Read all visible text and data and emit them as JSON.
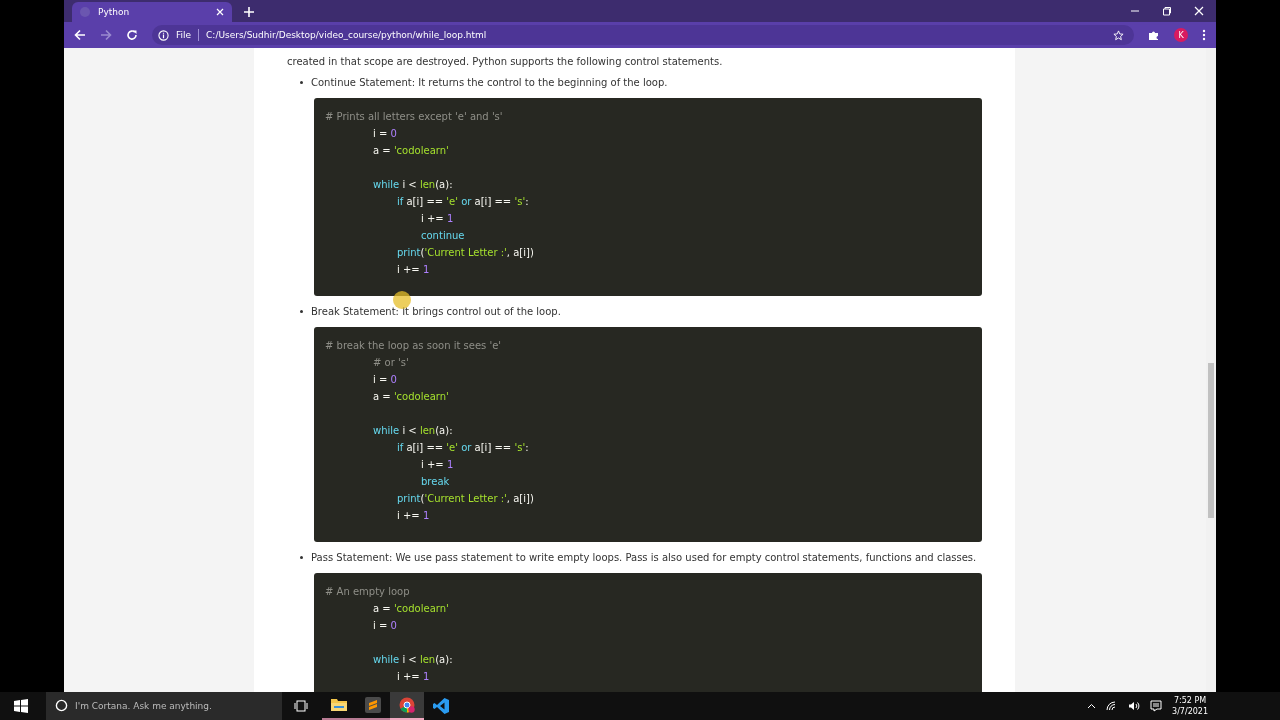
{
  "browser": {
    "tab": {
      "title": "Python",
      "selected": true
    },
    "nav": [
      {
        "kind": "back",
        "disabled": false
      },
      {
        "kind": "forward",
        "disabled": true
      },
      {
        "kind": "reload",
        "disabled": false
      }
    ],
    "address_bar": {
      "scheme": "File",
      "url": "C:/Users/Sudhir/Desktop/video_course/python/while_loop.html"
    },
    "profile_initial": "K"
  },
  "page": {
    "intro": "created in that scope are destroyed. Python supports the following control statements.",
    "items": [
      {
        "label": "Continue Statement: It returns the control to the beginning of the loop.",
        "code": [
          {
            "kind": "code",
            "tokens": [
              {
                "kind": "comment",
                "text": "# Prints all letters except 'e' and 's'"
              }
            ],
            "children": [
              {
                "kind": "code",
                "tokens": [
                  {
                    "kind": "plain",
                    "text": "i = "
                  },
                  {
                    "kind": "number",
                    "text": "0"
                  }
                ]
              },
              {
                "kind": "code",
                "tokens": [
                  {
                    "kind": "plain",
                    "text": "a = "
                  },
                  {
                    "kind": "string",
                    "text": "'codolearn'"
                  }
                ]
              },
              {
                "kind": "blank"
              },
              {
                "kind": "code",
                "tokens": [
                  {
                    "kind": "keyword",
                    "text": "while"
                  },
                  {
                    "kind": "plain",
                    "text": " i < "
                  },
                  {
                    "kind": "builtin",
                    "text": "len"
                  },
                  {
                    "kind": "plain",
                    "text": "(a):"
                  }
                ],
                "children": [
                  {
                    "kind": "code",
                    "tokens": [
                      {
                        "kind": "keyword",
                        "text": "if"
                      },
                      {
                        "kind": "plain",
                        "text": " a[i] == "
                      },
                      {
                        "kind": "string",
                        "text": "'e'"
                      },
                      {
                        "kind": "keyword",
                        "text": " or"
                      },
                      {
                        "kind": "plain",
                        "text": " a[i] == "
                      },
                      {
                        "kind": "string",
                        "text": "'s'"
                      },
                      {
                        "kind": "plain",
                        "text": ":"
                      }
                    ],
                    "children": [
                      {
                        "kind": "code",
                        "tokens": [
                          {
                            "kind": "plain",
                            "text": "i += "
                          },
                          {
                            "kind": "number",
                            "text": "1"
                          }
                        ]
                      },
                      {
                        "kind": "code",
                        "tokens": [
                          {
                            "kind": "keyword",
                            "text": "continue"
                          }
                        ]
                      }
                    ]
                  },
                  {
                    "kind": "code",
                    "tokens": [
                      {
                        "kind": "call",
                        "text": "print"
                      },
                      {
                        "kind": "plain",
                        "text": "("
                      },
                      {
                        "kind": "string",
                        "text": "'Current Letter :'"
                      },
                      {
                        "kind": "plain",
                        "text": ", a[i])"
                      }
                    ]
                  },
                  {
                    "kind": "code",
                    "tokens": [
                      {
                        "kind": "plain",
                        "text": "i += "
                      },
                      {
                        "kind": "number",
                        "text": "1"
                      }
                    ]
                  }
                ]
              }
            ]
          }
        ]
      },
      {
        "label": "Break Statement: It brings control out of the loop.",
        "code": [
          {
            "kind": "code",
            "tokens": [
              {
                "kind": "comment",
                "text": "# break the loop as soon it sees 'e'"
              }
            ],
            "children": [
              {
                "kind": "code",
                "tokens": [
                  {
                    "kind": "comment",
                    "text": "# or 's'"
                  }
                ]
              },
              {
                "kind": "code",
                "tokens": [
                  {
                    "kind": "plain",
                    "text": "i = "
                  },
                  {
                    "kind": "number",
                    "text": "0"
                  }
                ]
              },
              {
                "kind": "code",
                "tokens": [
                  {
                    "kind": "plain",
                    "text": "a = "
                  },
                  {
                    "kind": "string",
                    "text": "'codolearn'"
                  }
                ]
              },
              {
                "kind": "blank"
              },
              {
                "kind": "code",
                "tokens": [
                  {
                    "kind": "keyword",
                    "text": "while"
                  },
                  {
                    "kind": "plain",
                    "text": " i < "
                  },
                  {
                    "kind": "builtin",
                    "text": "len"
                  },
                  {
                    "kind": "plain",
                    "text": "(a):"
                  }
                ],
                "children": [
                  {
                    "kind": "code",
                    "tokens": [
                      {
                        "kind": "keyword",
                        "text": "if"
                      },
                      {
                        "kind": "plain",
                        "text": " a[i] == "
                      },
                      {
                        "kind": "string",
                        "text": "'e'"
                      },
                      {
                        "kind": "keyword",
                        "text": " or"
                      },
                      {
                        "kind": "plain",
                        "text": " a[i] == "
                      },
                      {
                        "kind": "string",
                        "text": "'s'"
                      },
                      {
                        "kind": "plain",
                        "text": ":"
                      }
                    ],
                    "children": [
                      {
                        "kind": "code",
                        "tokens": [
                          {
                            "kind": "plain",
                            "text": "i += "
                          },
                          {
                            "kind": "number",
                            "text": "1"
                          }
                        ]
                      },
                      {
                        "kind": "code",
                        "tokens": [
                          {
                            "kind": "keyword",
                            "text": "break"
                          }
                        ]
                      }
                    ]
                  },
                  {
                    "kind": "code",
                    "tokens": [
                      {
                        "kind": "call",
                        "text": "print"
                      },
                      {
                        "kind": "plain",
                        "text": "("
                      },
                      {
                        "kind": "string",
                        "text": "'Current Letter :'"
                      },
                      {
                        "kind": "plain",
                        "text": ", a[i])"
                      }
                    ]
                  },
                  {
                    "kind": "code",
                    "tokens": [
                      {
                        "kind": "plain",
                        "text": "i += "
                      },
                      {
                        "kind": "number",
                        "text": "1"
                      }
                    ]
                  }
                ]
              }
            ]
          }
        ]
      },
      {
        "label": "Pass Statement: We use pass statement to write empty loops. Pass is also used for empty control statements, functions and classes.",
        "code": [
          {
            "kind": "code",
            "tokens": [
              {
                "kind": "comment",
                "text": "# An empty loop"
              }
            ],
            "children": [
              {
                "kind": "code",
                "tokens": [
                  {
                    "kind": "plain",
                    "text": "a = "
                  },
                  {
                    "kind": "string",
                    "text": "'codolearn'"
                  }
                ]
              },
              {
                "kind": "code",
                "tokens": [
                  {
                    "kind": "plain",
                    "text": "i = "
                  },
                  {
                    "kind": "number",
                    "text": "0"
                  }
                ]
              },
              {
                "kind": "blank"
              },
              {
                "kind": "code",
                "tokens": [
                  {
                    "kind": "keyword",
                    "text": "while"
                  },
                  {
                    "kind": "plain",
                    "text": " i < "
                  },
                  {
                    "kind": "builtin",
                    "text": "len"
                  },
                  {
                    "kind": "plain",
                    "text": "(a):"
                  }
                ],
                "children": [
                  {
                    "kind": "code",
                    "tokens": [
                      {
                        "kind": "plain",
                        "text": "i += "
                      },
                      {
                        "kind": "number",
                        "text": "1"
                      }
                    ]
                  }
                ]
              }
            ]
          }
        ]
      }
    ]
  },
  "taskbar": {
    "search": {
      "placeholder": "I'm Cortana. Ask me anything."
    },
    "apps": [
      {
        "kind": "explorer",
        "running": true,
        "selected": false
      },
      {
        "kind": "sublime",
        "running": true,
        "selected": false
      },
      {
        "kind": "chrome",
        "running": true,
        "selected": true
      },
      {
        "kind": "vscode",
        "running": false,
        "selected": false
      }
    ],
    "time": "7:52 PM",
    "date": "3/7/2021"
  }
}
